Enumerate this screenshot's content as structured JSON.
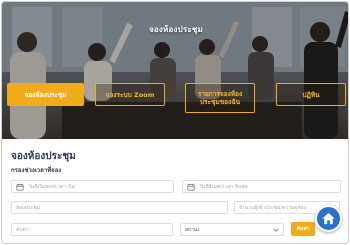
{
  "hero": {
    "title": "จองห้องประชุม",
    "buttons": [
      {
        "label": "จองห้องประชุม",
        "active": true
      },
      {
        "label": "จองระบบ Zoom",
        "active": false
      },
      {
        "label": "รายการจองห้อง\nประชุมของฉัน",
        "active": false
      },
      {
        "label": "ปฏิทิน",
        "active": false
      }
    ]
  },
  "form": {
    "title": "จองห้องประชุม",
    "filter_label": "กรองช่วงเวลาที่จอง",
    "start_date": {
      "placeholder": "วันที่เริ่มจอง/เวลา เริ่ม"
    },
    "end_date": {
      "placeholder": "วันที่สิ้นสุด/เวลา สิ้นสุด"
    },
    "room": {
      "placeholder": "ห้องประชุม"
    },
    "attendees": {
      "placeholder": "จำนวนผู้เข้าประชุม/ความจุห้อง"
    },
    "name": {
      "placeholder": "ค้นหา"
    },
    "status": {
      "value": "สถานะ"
    },
    "search_label": "ค้นหา"
  },
  "colors": {
    "accent": "#f2ab1b",
    "title": "#2f3a56",
    "fab": "#2a72c9"
  },
  "icons": {
    "calendar": "calendar-icon",
    "chevron": "chevron-down-icon",
    "home": "home-icon"
  }
}
